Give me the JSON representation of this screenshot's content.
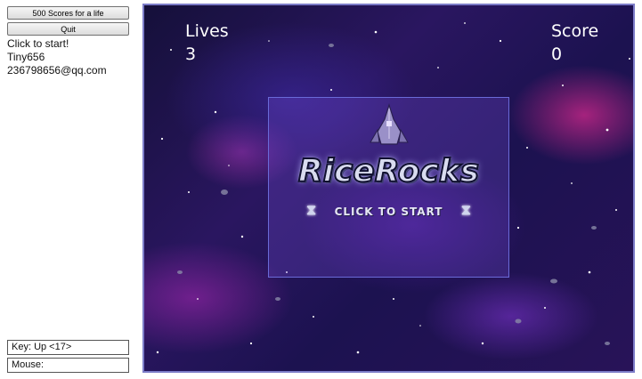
{
  "panel": {
    "bonus_button": "500 Scores for a life",
    "quit_button": "Quit",
    "lines": [
      "Click to start!",
      "Tiny656",
      "236798656@qq.com"
    ],
    "key_status": "Key: Up <17>",
    "mouse_status": "Mouse:"
  },
  "game": {
    "lives_label": "Lives",
    "lives_value": "3",
    "score_label": "Score",
    "score_value": "0",
    "logo_text": "RiceRocks",
    "cta_text": "CLICK TO START"
  }
}
